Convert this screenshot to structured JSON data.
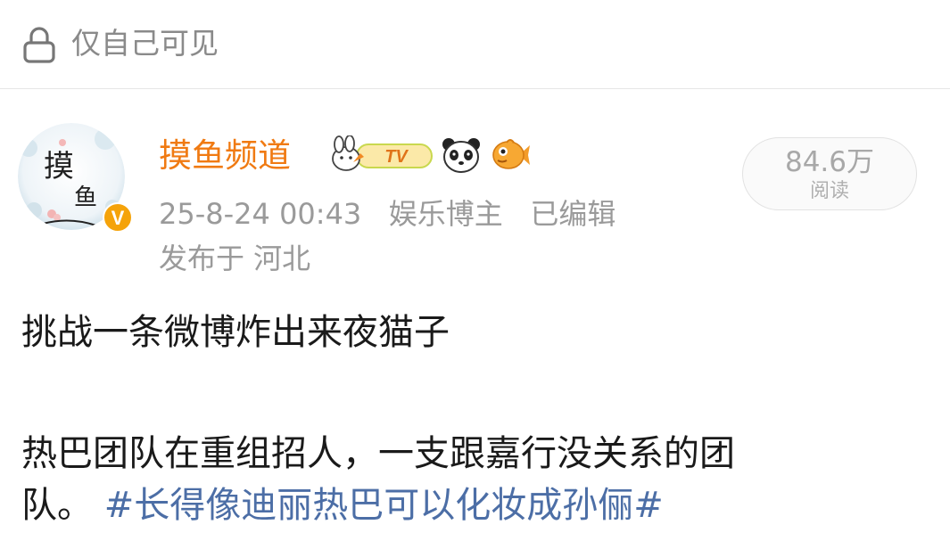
{
  "privacy": {
    "label": "仅自己可见"
  },
  "author": {
    "name": "摸鱼频道",
    "avatar_text_1": "摸",
    "avatar_text_2": "鱼",
    "verified_mark": "V",
    "tv_badge": "TV"
  },
  "meta": {
    "timestamp": "25-8-24 00:43",
    "role": "娱乐博主",
    "edited": "已编辑",
    "location": "发布于 河北"
  },
  "reads": {
    "count": "84.6万",
    "label": "阅读"
  },
  "post": {
    "line1": "挑战一条微博炸出来夜猫子",
    "line2": "热巴团队在重组招人，一支跟嘉行没关系的团",
    "line3": "队。",
    "hashtag": "#长得像迪丽热巴可以化妆成孙俪#"
  },
  "colors": {
    "author_name": "#f07a12",
    "hashtag": "#4c6ea6",
    "verified": "#f5a30a",
    "meta_text": "#9a9a9a"
  }
}
